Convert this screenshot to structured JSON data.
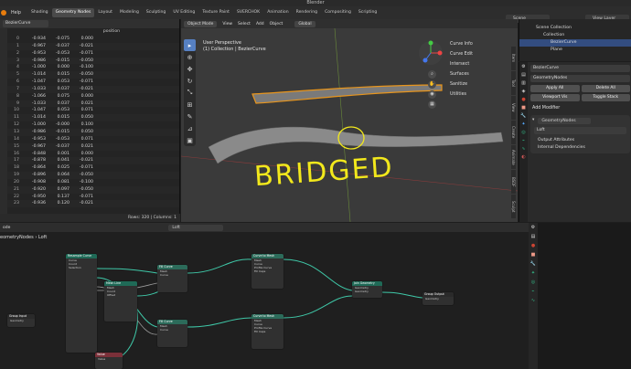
{
  "window": {
    "title": "Blender"
  },
  "menubar": {
    "items": [
      "File",
      "Edit",
      "Render",
      "Window",
      "Help"
    ],
    "visible_items": [
      "Help"
    ],
    "tabs": [
      "Shading",
      "Geometry Nodes",
      "Layout",
      "Modeling",
      "Sculpting",
      "UV Editing",
      "Texture Paint",
      "SVERCHOK",
      "Animation",
      "Rendering",
      "Compositing",
      "Scripting"
    ],
    "active_tab": "Geometry Nodes",
    "scene": "Scene",
    "view_layer": "View Layer"
  },
  "spreadsheet": {
    "object": "BezierCurve",
    "column_header": "position",
    "rows": [
      [
        "0",
        "-0.934",
        "-0.075",
        "0.000"
      ],
      [
        "1",
        "-0.967",
        "-0.037",
        "-0.021"
      ],
      [
        "2",
        "-0.953",
        "-0.053",
        "-0.071"
      ],
      [
        "3",
        "-0.986",
        "-0.015",
        "-0.050"
      ],
      [
        "4",
        "-1.000",
        "0.000",
        "-0.100"
      ],
      [
        "5",
        "-1.014",
        "0.015",
        "-0.050"
      ],
      [
        "6",
        "-1.047",
        "0.053",
        "-0.071"
      ],
      [
        "7",
        "-1.033",
        "0.037",
        "-0.021"
      ],
      [
        "8",
        "-1.066",
        "0.075",
        "0.000"
      ],
      [
        "9",
        "-1.033",
        "0.037",
        "0.021"
      ],
      [
        "10",
        "-1.047",
        "0.053",
        "0.071"
      ],
      [
        "11",
        "-1.014",
        "0.015",
        "0.050"
      ],
      [
        "12",
        "-1.000",
        "-0.000",
        "0.100"
      ],
      [
        "13",
        "-0.986",
        "-0.015",
        "0.050"
      ],
      [
        "14",
        "-0.953",
        "-0.053",
        "0.071"
      ],
      [
        "15",
        "-0.967",
        "-0.037",
        "0.021"
      ],
      [
        "16",
        "-0.848",
        "0.001",
        "0.000"
      ],
      [
        "17",
        "-0.878",
        "0.041",
        "-0.021"
      ],
      [
        "18",
        "-0.864",
        "0.025",
        "-0.071"
      ],
      [
        "19",
        "-0.896",
        "0.064",
        "-0.050"
      ],
      [
        "20",
        "-0.908",
        "0.081",
        "-0.100"
      ],
      [
        "21",
        "-0.920",
        "0.097",
        "-0.050"
      ],
      [
        "22",
        "-0.950",
        "0.137",
        "-0.071"
      ],
      [
        "23",
        "-0.936",
        "0.120",
        "-0.021"
      ]
    ],
    "footer": "Rows: 320 | Columns: 1"
  },
  "viewport": {
    "mode": "Object Mode",
    "menus": [
      "View",
      "Select",
      "Add",
      "Object"
    ],
    "orientation": "Global",
    "info_line1": "User Perspective",
    "info_line2": "(1) Collection | BezierCurve",
    "annotation": "BRIDGED",
    "side_panel": [
      "Curve Info",
      "Curve Edit",
      "Intersect",
      "Surfaces",
      "Sanitize",
      "Utilities"
    ],
    "side_tabs": [
      "Item",
      "Tool",
      "View",
      "Create",
      "Animate",
      "BSDF",
      "Sculpt",
      "Tissue",
      "Edit"
    ]
  },
  "outliner": {
    "rows": [
      "Scene Collection",
      "Collection",
      "BezierCurve",
      "Plane"
    ],
    "selected": "BezierCurve"
  },
  "properties": {
    "object": "BezierCurve",
    "modifier_type": "GeometryNodes",
    "apply_label": "Apply All",
    "delete_label": "Delete All",
    "viewport_vis_label": "Viewport Vis",
    "toggle_stack_label": "Toggle Stack",
    "add_modifier_label": "Add Modifier",
    "modifier_name": "GeometryNodes",
    "node_group": "Loft",
    "sections": [
      "Output Attributes",
      "Internal Dependencies"
    ]
  },
  "node_editor": {
    "header_left": "ode",
    "group_field": "Loft",
    "breadcrumb_root": "eometryNodes",
    "breadcrumb_child": "Loft",
    "nodes": [
      {
        "title": "Group Input",
        "rows": [
          "Geometry"
        ]
      },
      {
        "title": "Resample Curve",
        "rows": [
          "Curve",
          "Count",
          "Selection"
        ]
      },
      {
        "title": "Mesh Line",
        "rows": [
          "Mesh",
          "Count",
          "Offset"
        ]
      },
      {
        "title": "Fill Curve",
        "rows": [
          "Mesh",
          "Curve"
        ]
      },
      {
        "title": "Curve to Mesh",
        "rows": [
          "Mesh",
          "Curve",
          "Profile Curve",
          "Fill Caps"
        ]
      },
      {
        "title": "Fill Curve",
        "rows": [
          "Mesh",
          "Curve"
        ]
      },
      {
        "title": "Curve to Mesh",
        "rows": [
          "Mesh",
          "Curve",
          "Profile Curve",
          "Fill Caps"
        ]
      },
      {
        "title": "Join Geometry",
        "rows": [
          "Geometry",
          "Geometry"
        ]
      },
      {
        "title": "Group Output",
        "rows": [
          "Geometry"
        ]
      },
      {
        "title": "Value",
        "rows": [
          "Value"
        ]
      }
    ]
  }
}
